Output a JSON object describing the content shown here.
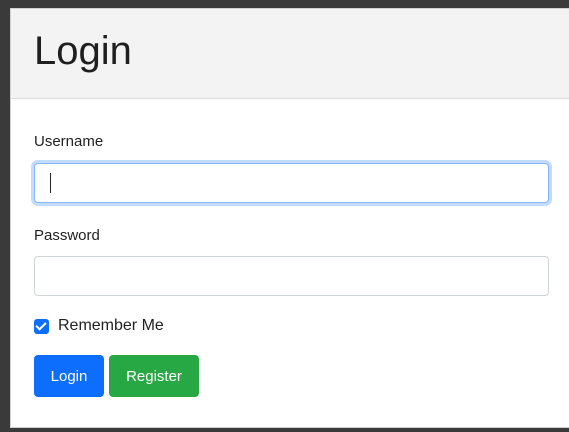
{
  "form": {
    "title": "Login",
    "username_label": "Username",
    "username_value": "",
    "password_label": "Password",
    "password_value": "",
    "remember_label": "Remember Me",
    "remember_checked": true,
    "login_button": "Login",
    "register_button": "Register"
  },
  "colors": {
    "primary": "#0d6efd",
    "success": "#28a745",
    "header_bg": "#f3f3f3"
  }
}
